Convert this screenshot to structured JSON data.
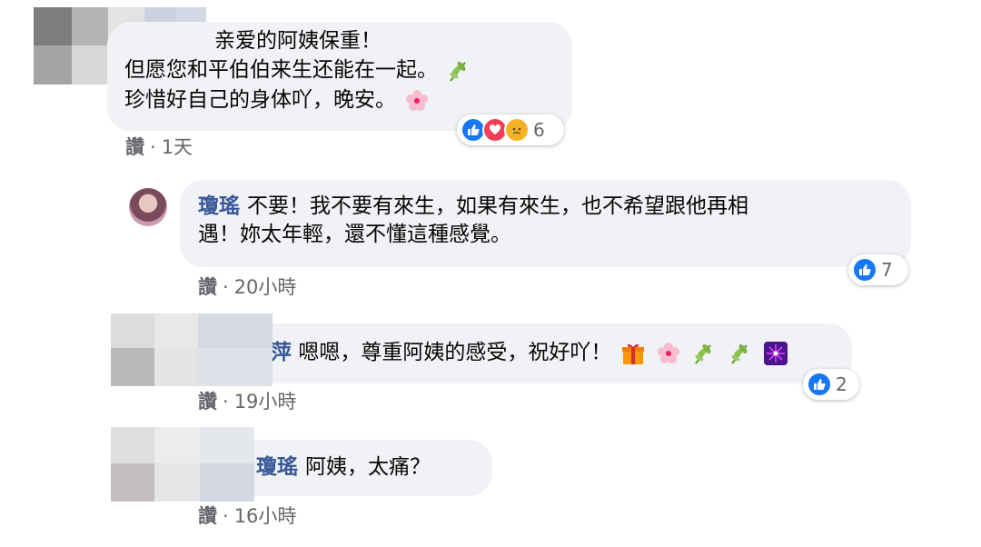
{
  "comments": [
    {
      "text_line1": "亲爱的阿姨保重！",
      "text_line2": "但愿您和平伯伯来生还能在一起。",
      "text_line3": "珍惜好自己的身体吖，晚安。",
      "action": "讚",
      "time": "1天",
      "reaction_count": "6",
      "reactions": [
        "like",
        "love",
        "sad"
      ]
    },
    {
      "author": "瓊瑤",
      "text_line1": "不要！我不要有來生，如果有來生，也不希望跟他再相",
      "text_line2": "遇！妳太年輕，還不懂這種感覺。",
      "action": "讚",
      "time": "20小時",
      "reaction_count": "7",
      "reactions": [
        "like"
      ]
    },
    {
      "author_partial": "萍",
      "text": "嗯嗯，尊重阿姨的感受，祝好吖！",
      "action": "讚",
      "time": "19小時",
      "reaction_count": "2",
      "reactions": [
        "like"
      ]
    },
    {
      "author": "瓊瑤",
      "text": "阿姨，太痛？",
      "action": "讚",
      "time": "16小時"
    }
  ],
  "colors": {
    "bubble": "#f0f2f5",
    "name": "#385898",
    "meta": "#65676b",
    "like": "#1877f2",
    "love": "#f33e58",
    "sad": "#f7b125"
  }
}
